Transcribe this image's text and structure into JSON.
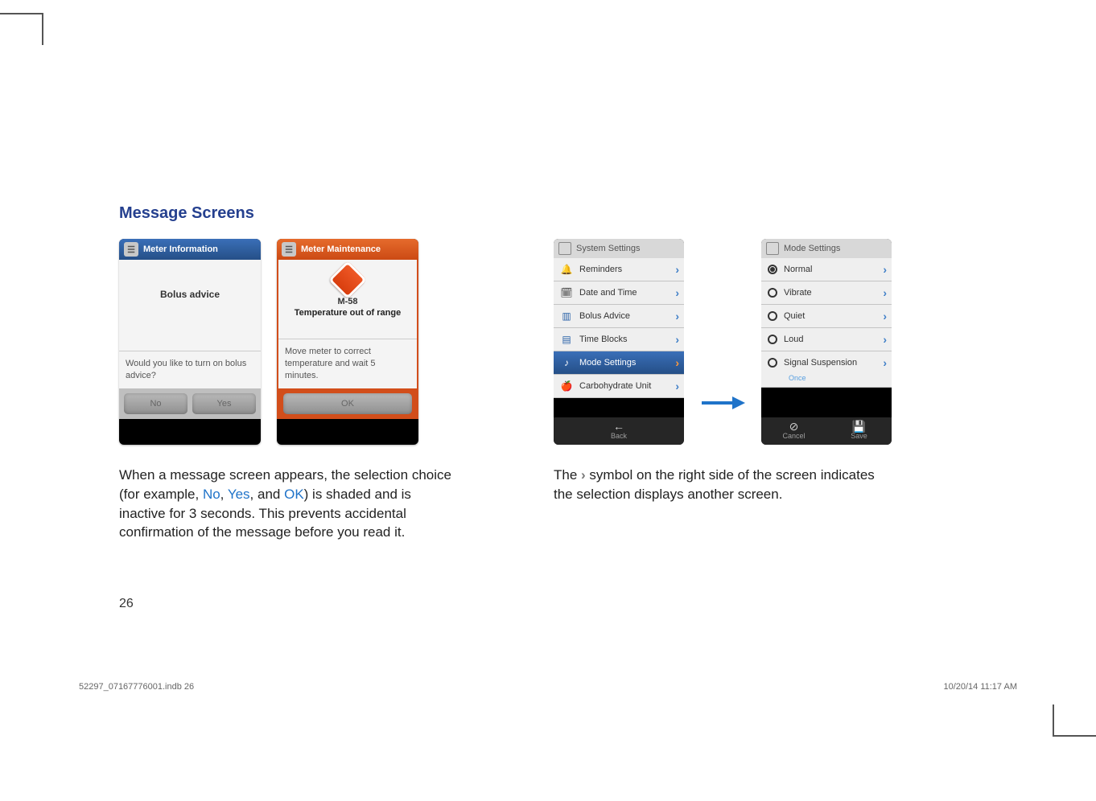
{
  "section_heading": "Message Screens",
  "screen1": {
    "title": "Meter Information",
    "subject": "Bolus advice",
    "question": "Would you like to turn on bolus advice?",
    "btn_no": "No",
    "btn_yes": "Yes"
  },
  "screen2": {
    "title": "Meter Maintenance",
    "code": "M-58",
    "name": "Temperature out of range",
    "instruction": "Move meter to correct temperature and wait 5 minutes.",
    "btn_ok": "OK"
  },
  "left_paragraph_a": "When a message screen appears, the selection choice (for example, ",
  "left_hl_no": "No",
  "left_comma1": ", ",
  "left_hl_yes": "Yes",
  "left_comma2": ", and ",
  "left_hl_ok": "OK",
  "left_paragraph_b": ") is shaded and is inactive for 3 seconds. This prevents accidental confirmation of the message before you read it.",
  "screen3": {
    "header": "System Settings",
    "r1": "Reminders",
    "r2": "Date and Time",
    "r3": "Bolus Advice",
    "r4": "Time Blocks",
    "r5": "Mode Settings",
    "r6": "Carbohydrate Unit",
    "back": "Back"
  },
  "screen4": {
    "header": "Mode Settings",
    "r1": "Normal",
    "r2": "Vibrate",
    "r3": "Quiet",
    "r4": "Loud",
    "r5": "Signal Suspension",
    "r5_sub": "Once",
    "cancel": "Cancel",
    "save": "Save"
  },
  "right_paragraph_a": "The ",
  "chev_symbol": "›",
  "right_paragraph_b": " symbol on the right side of the screen indicates the selection displays another screen.",
  "page_number": "26",
  "footer_file": "52297_07167776001.indb   26",
  "footer_date": "10/20/14   11:17 AM"
}
